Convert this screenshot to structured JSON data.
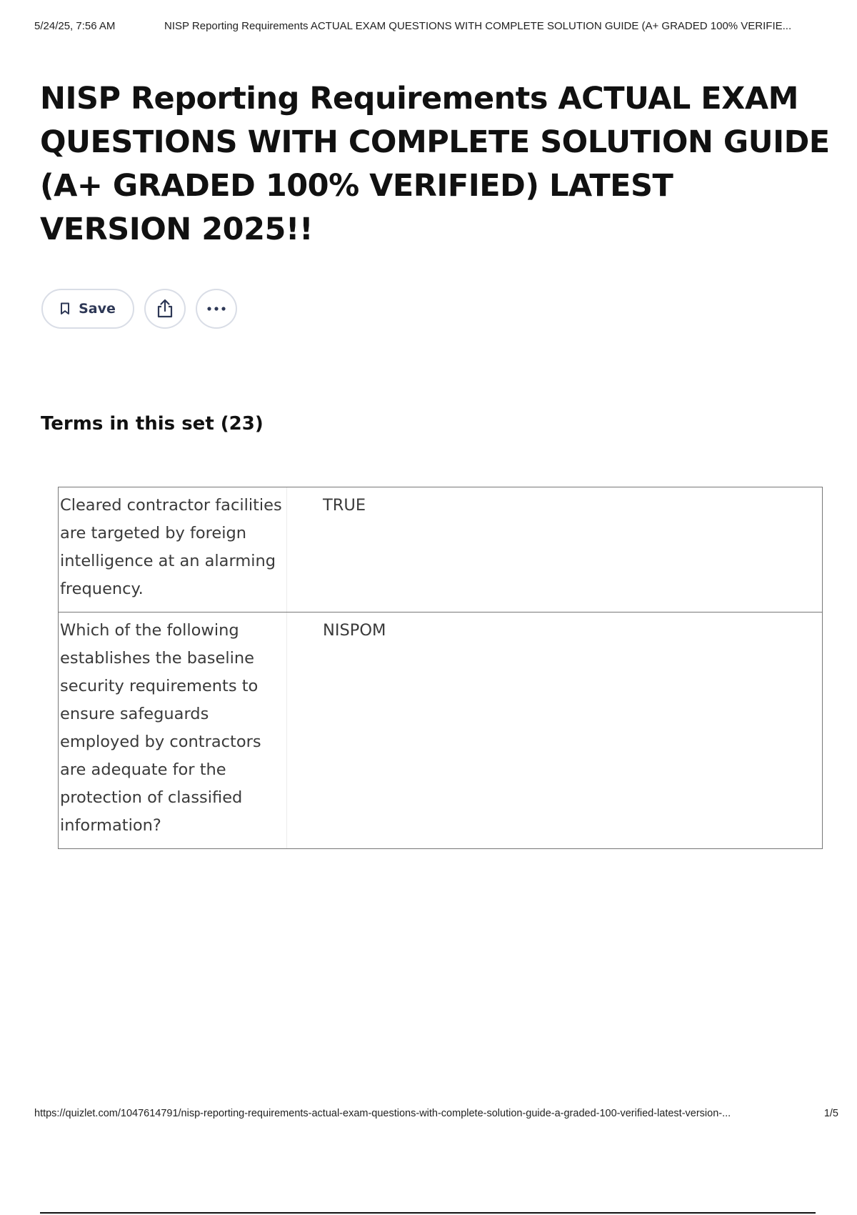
{
  "print_header": {
    "datetime": "5/24/25, 7:56 AM",
    "doc_title": "NISP Reporting Requirements ACTUAL EXAM QUESTIONS WITH COMPLETE SOLUTION GUIDE (A+ GRADED 100% VERIFIE..."
  },
  "set": {
    "title": "NISP Reporting Requirements ACTUAL EXAM QUESTIONS WITH COMPLETE SOLUTION GUIDE (A+ GRADED 100% VERIFIED) LATEST VERSION 2025!!"
  },
  "actions": {
    "save_label": "Save",
    "save_icon": "bookmark-icon",
    "share_icon": "share-icon",
    "more_icon": "more-horizontal-icon"
  },
  "terms": {
    "heading": "Terms in this set (23)",
    "rows": [
      {
        "term": "Cleared contractor facilities are targeted by foreign intelligence at an alarming frequency.",
        "definition": "TRUE"
      },
      {
        "term": "Which of the following establishes the baseline security requirements to ensure safeguards employed by contractors are adequate for the protection of classified information?",
        "definition": "NISPOM"
      }
    ]
  },
  "print_footer": {
    "url": "https://quizlet.com/1047614791/nisp-reporting-requirements-actual-exam-questions-with-complete-solution-guide-a-graded-100-verified-latest-version-...",
    "page": "1/5"
  }
}
